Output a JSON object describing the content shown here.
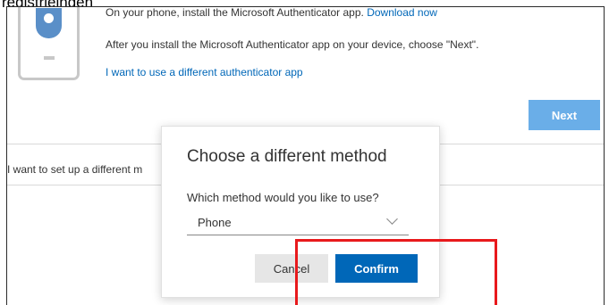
{
  "caption": "registrieingen",
  "setup": {
    "line1_text": "On your phone, install the Microsoft Authenticator app.",
    "line1_link": "Download now",
    "line2_text": "After you install the Microsoft Authenticator app on your device, choose \"Next\".",
    "alt_app_link": "I want to use a different authenticator app",
    "next_label": "Next",
    "footer_text": "I want to set up a different m"
  },
  "dialog": {
    "title": "Choose a different method",
    "label": "Which method would you like to use?",
    "selected_method": "Phone",
    "cancel_label": "Cancel",
    "confirm_label": "Confirm"
  },
  "colors": {
    "accent": "#0067b8",
    "next_disabled": "#6aaee8",
    "highlight": "#e8191c"
  },
  "icons": {
    "phone": "authenticator-phone-icon",
    "dropdown": "chevron-down-icon"
  }
}
